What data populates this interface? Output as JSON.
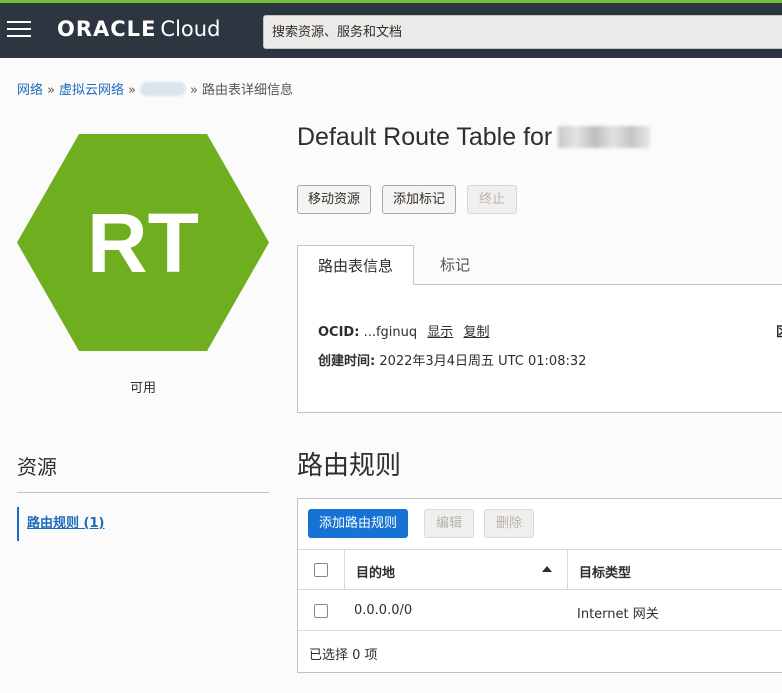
{
  "header": {
    "brand_oracle": "ORACLE",
    "brand_cloud": "Cloud",
    "search_placeholder": "搜索资源、服务和文档"
  },
  "breadcrumb": {
    "items": [
      "网络",
      "虚拟云网络"
    ],
    "separator": "»",
    "current": "路由表详细信息"
  },
  "resource_icon": {
    "abbreviation": "RT",
    "color": "#6fae1e",
    "status": "可用"
  },
  "title": {
    "text": "Default Route Table for"
  },
  "actions": {
    "move": "移动资源",
    "add_tag": "添加标记",
    "terminate": "终止"
  },
  "tabs": {
    "info": "路由表信息",
    "tags": "标记"
  },
  "details": {
    "ocid_label": "OCID:",
    "ocid_value": "...fginuq",
    "show": "显示",
    "copy": "复制",
    "created_label": "创建时间:",
    "created_value": "2022年3月4日周五 UTC 01:08:32",
    "edge_glyph": "区"
  },
  "resources": {
    "heading": "资源",
    "items": [
      "路由规则 (1)"
    ]
  },
  "rules": {
    "title": "路由规则",
    "add_button": "添加路由规则",
    "edit_button": "编辑",
    "delete_button": "删除",
    "columns": [
      "目的地",
      "目标类型"
    ],
    "rows": [
      {
        "destination": "0.0.0.0/0",
        "target_type": "Internet 网关"
      }
    ],
    "selection_footer": "已选择 0 项"
  },
  "colors": {
    "topbar": "#2d3540",
    "accent_green": "#6fbf3a",
    "link": "#1d6bbd",
    "primary_button": "#1672d4"
  }
}
